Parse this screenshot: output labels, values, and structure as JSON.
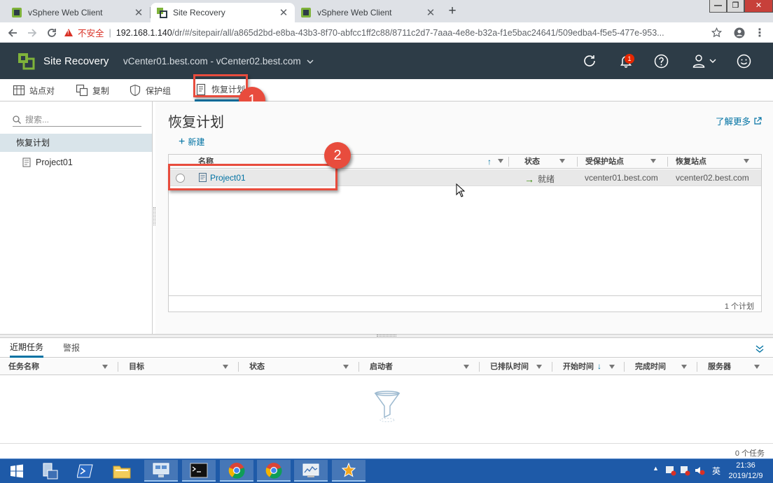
{
  "browser": {
    "tabs": [
      {
        "title": "vSphere Web Client",
        "active": false
      },
      {
        "title": "Site Recovery",
        "active": true
      },
      {
        "title": "vSphere Web Client",
        "active": false
      }
    ],
    "new_tab_icon": "plus-icon",
    "window_controls": [
      "minimize",
      "restore",
      "close"
    ],
    "security_label": "不安全",
    "url_host": "192.168.1.140",
    "url_path": "/dr/#/sitepair/all/a865d2bd-e8ba-43b3-8f70-abfcc1ff2c88/8711c2d7-7aaa-4e8e-b32a-f1e5bac24641/509edba4-f5e5-477e-953..."
  },
  "app": {
    "name": "Site Recovery",
    "site_pair": "vCenter01.best.com - vCenter02.best.com",
    "notification_count": "1",
    "accent_color": "#0072a3",
    "header_color": "#2d3c47"
  },
  "nav": {
    "tabs": [
      {
        "label": "站点对",
        "icon": "site-pair-icon"
      },
      {
        "label": "复制",
        "icon": "replication-icon"
      },
      {
        "label": "保护组",
        "icon": "shield-icon"
      },
      {
        "label": "恢复计划",
        "icon": "plan-icon",
        "active": true
      }
    ]
  },
  "sidebar": {
    "search_placeholder": "搜索...",
    "selected_item": "恢复计划",
    "items": [
      {
        "label": "Project01"
      }
    ]
  },
  "main": {
    "title": "恢复计划",
    "learn_more": "了解更多",
    "new_button": "新建",
    "columns": [
      "名称",
      "状态",
      "受保护站点",
      "恢复站点"
    ],
    "rows": [
      {
        "name": "Project01",
        "status": "就绪",
        "protected_site": "vcenter01.best.com",
        "recovery_site": "vcenter02.best.com"
      }
    ],
    "count": "1 个计划"
  },
  "callouts": [
    "1",
    "2"
  ],
  "bottom": {
    "tabs": [
      "近期任务",
      "警报"
    ],
    "columns": [
      "任务名称",
      "目标",
      "状态",
      "启动者",
      "已排队时间",
      "开始时间",
      "完成时间",
      "服务器"
    ],
    "count": "0 个任务"
  },
  "taskbar": {
    "tray_lang": "英",
    "time": "21:36",
    "date": "2019/12/9"
  }
}
